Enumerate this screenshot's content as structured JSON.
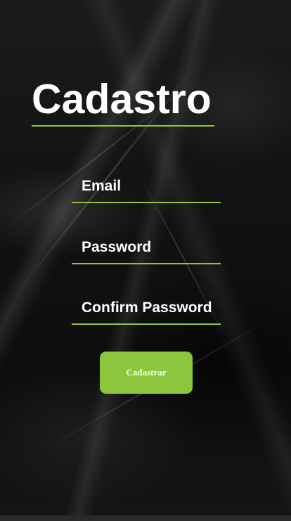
{
  "form": {
    "title": "Cadastro",
    "email": {
      "placeholder": "Email",
      "value": ""
    },
    "password": {
      "placeholder": "Password",
      "value": ""
    },
    "confirm_password": {
      "placeholder": "Confirm Password",
      "value": ""
    },
    "submit_label": "Cadastrar"
  },
  "colors": {
    "accent": "#8cc63f",
    "text": "#ffffff",
    "background": "#121212"
  }
}
